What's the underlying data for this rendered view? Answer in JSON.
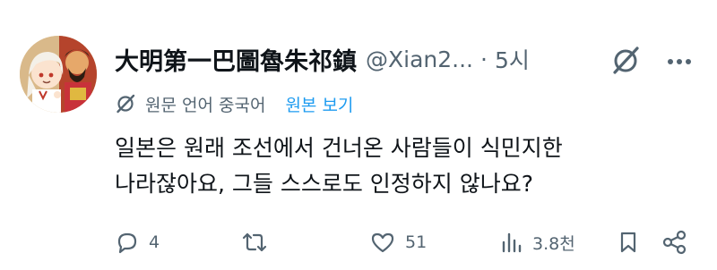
{
  "tweet": {
    "author": {
      "display_name": "大明第一巴圖魯朱祁鎮",
      "handle": "@Xian2...",
      "separator": "·",
      "time": "5시",
      "avatar_icon": "avatar-illustration-icon"
    },
    "translation": {
      "note": "원문 언어 중국어",
      "show_original_label": "원본 보기",
      "icon": "grok-translate-icon"
    },
    "text_lines": [
      "일본은 원래 조선에서 건너온 사람들이 식민지한",
      "나라잖아요, 그들 스스로도 인정하지 않나요?"
    ],
    "actions": {
      "reply": {
        "icon": "reply-icon",
        "count": "4"
      },
      "retweet": {
        "icon": "retweet-icon",
        "count": ""
      },
      "like": {
        "icon": "heart-icon",
        "count": "51"
      },
      "views": {
        "icon": "views-icon",
        "count": "3.8천"
      },
      "bookmark": {
        "icon": "bookmark-icon"
      },
      "share": {
        "icon": "share-icon"
      }
    },
    "header_icons": [
      "grok-icon",
      "more-icon"
    ]
  },
  "colors": {
    "text_primary": "#0f1419",
    "text_secondary": "#536471",
    "accent": "#1d9bf0",
    "background": "#ffffff"
  }
}
